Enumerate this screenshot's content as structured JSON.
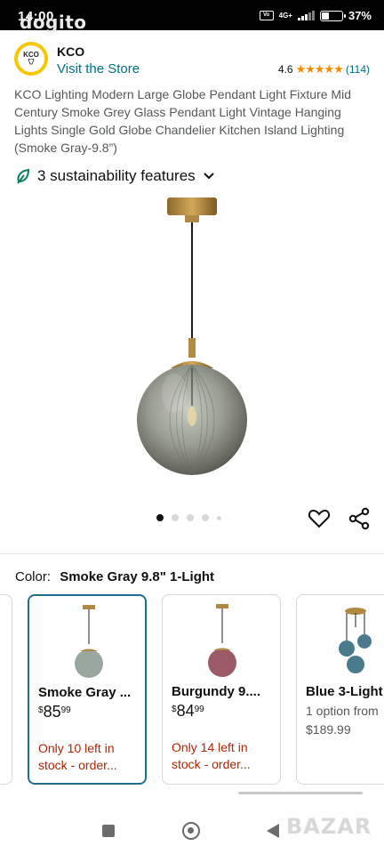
{
  "status_bar": {
    "time": "14:00",
    "watermark": "dogito",
    "network": "4G+",
    "battery_pct": "37%",
    "battery_level": 0.37
  },
  "store": {
    "logo_text": "KCO",
    "name": "KCO",
    "visit_label": "Visit the Store",
    "rating": "4.6",
    "stars": "★★★★★",
    "review_count": "(114)"
  },
  "product": {
    "title": "KCO Lighting Modern Large Globe Pendant Light Fixture Mid Century Smoke Grey Glass Pendant Light Vintage Hanging Lights Single Gold Globe Chandelier Kitchen Island Lighting (Smoke Gray-9.8”)",
    "sustainability_label": "3 sustainability features",
    "image_count": 5,
    "active_image": 1
  },
  "color": {
    "label": "Color:",
    "selected": "Smoke Gray 9.8\" 1-Light"
  },
  "variants": [
    {
      "name": "Smoke Gray ...",
      "currency": "$",
      "price_whole": "85",
      "price_cents": "99",
      "stock": "Only 10 left in stock - order...",
      "selected": true,
      "globe_color": "#9aa79e"
    },
    {
      "name": "Burgundy 9....",
      "currency": "$",
      "price_whole": "84",
      "price_cents": "99",
      "stock": "Only 14 left in stock - order...",
      "selected": false,
      "globe_color": "#9a5a66"
    },
    {
      "name": "Blue 3-Light",
      "options": "1 option from",
      "option_price": "$189.99",
      "selected": false,
      "globe_color": "#4a7b8c"
    }
  ],
  "watermark_bottom": "BAZAR",
  "colors": {
    "link": "#007185",
    "stock_red": "#b12704",
    "star_orange": "#f08c00",
    "selected_border": "#1f6f8b"
  }
}
